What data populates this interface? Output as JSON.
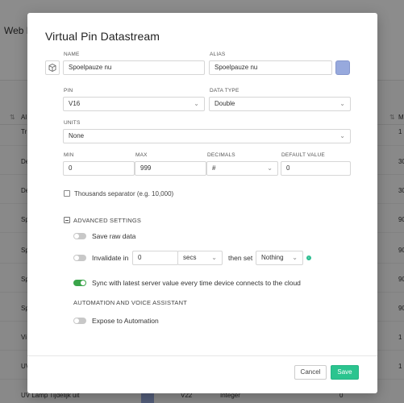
{
  "background": {
    "title": "Web D",
    "rows": [
      {
        "name": "Tr",
        "right": "1"
      },
      {
        "name": "De",
        "right": "30"
      },
      {
        "name": "De",
        "right": "30"
      },
      {
        "name": "Sp",
        "right": "90"
      },
      {
        "name": "Sp",
        "right": "90"
      },
      {
        "name": "Sp",
        "right": "90"
      },
      {
        "name": "Sp",
        "right": "90"
      },
      {
        "name": "Vi",
        "right": "1"
      },
      {
        "name": "UV",
        "right": "1"
      },
      {
        "name": "UV Lamp Tijdelijk uit",
        "pin": "V22",
        "type": "Integer",
        "value": "0"
      }
    ],
    "headers": {
      "col1": "Al",
      "col_right": "M"
    }
  },
  "modal": {
    "title": "Virtual Pin Datastream",
    "name": {
      "label": "NAME",
      "value": "Spoelpauze nu"
    },
    "alias": {
      "label": "ALIAS",
      "value": "Spoelpauze nu"
    },
    "pin": {
      "label": "PIN",
      "value": "V16"
    },
    "data_type": {
      "label": "DATA TYPE",
      "value": "Double"
    },
    "units": {
      "label": "UNITS",
      "value": "None"
    },
    "min": {
      "label": "MIN",
      "value": "0"
    },
    "max": {
      "label": "MAX",
      "value": "999"
    },
    "decimals": {
      "label": "DECIMALS",
      "value": "#"
    },
    "default_value": {
      "label": "DEFAULT VALUE",
      "value": "0"
    },
    "thousands_separator": {
      "label": "Thousands separator (e.g. 10,000)",
      "checked": false
    },
    "advanced": {
      "label": "ADVANCED SETTINGS",
      "save_raw": {
        "label": "Save raw data",
        "on": false
      },
      "invalidate": {
        "label": "Invalidate in",
        "value": "0",
        "unit": "secs",
        "then_set_label": "then set",
        "then_set_value": "Nothing",
        "on": false
      },
      "sync": {
        "label": "Sync with latest server value every time device connects to the cloud",
        "on": true
      },
      "automation_heading": "AUTOMATION AND VOICE ASSISTANT",
      "expose": {
        "label": "Expose to Automation",
        "on": false
      }
    },
    "buttons": {
      "cancel": "Cancel",
      "save": "Save"
    },
    "colors": {
      "accent": "#2bc48f",
      "swatch": "#97a9dd",
      "toggle_on": "#3aa54a"
    },
    "info_icon": "info-icon"
  }
}
